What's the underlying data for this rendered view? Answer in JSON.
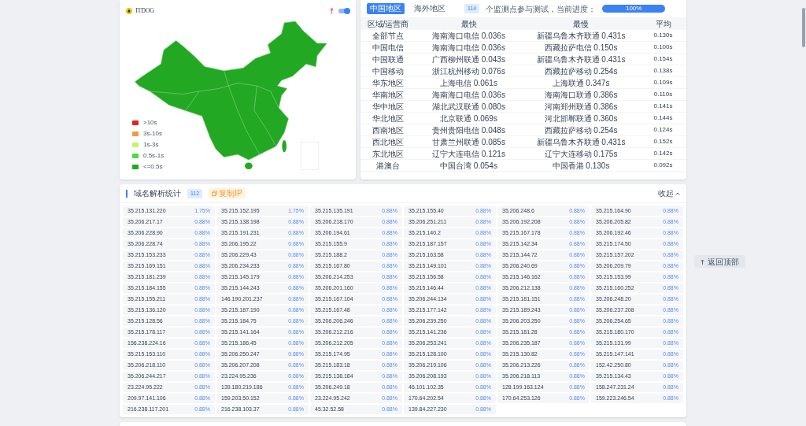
{
  "map_panel": {
    "logo": "ITDOG",
    "toggle": {
      "on": true
    },
    "legend": [
      {
        "label": ">10s",
        "color": "#e52222"
      },
      {
        "label": "3s-10s",
        "color": "#f59a3a"
      },
      {
        "label": "1s-3s",
        "color": "#c3f46a"
      },
      {
        "label": "0.5s-1s",
        "color": "#4bd84b"
      },
      {
        "label": "<=0.5s",
        "color": "#23a823"
      }
    ]
  },
  "region_panel": {
    "tabs": [
      {
        "label": "中国地区",
        "selected": true
      },
      {
        "label": "海外地区",
        "selected": false
      }
    ],
    "node_count": "114",
    "progress_text": "个监测点参与测试，当前进度：",
    "progress": {
      "level": 1,
      "reading": "100%"
    },
    "columns": [
      "区域/运营商",
      "最快",
      "最慢",
      "平均"
    ],
    "rows": [
      {
        "region": "全部节点",
        "fastest": "海南海口电信 0.036s",
        "slowest": "新疆乌鲁木齐联通 0.431s",
        "average": "0.130s"
      },
      {
        "region": "中国电信",
        "fastest": "海南海口电信 0.036s",
        "slowest": "西藏拉萨电信 0.150s",
        "average": "0.100s"
      },
      {
        "region": "中国联通",
        "fastest": "广西柳州联通 0.043s",
        "slowest": "新疆乌鲁木齐联通 0.431s",
        "average": "0.154s"
      },
      {
        "region": "中国移动",
        "fastest": "浙江杭州移动 0.076s",
        "slowest": "西藏拉萨移动 0.254s",
        "average": "0.138s"
      },
      {
        "region": "华东地区",
        "fastest": "上海电信 0.061s",
        "slowest": "上海联通 0.347s",
        "average": "0.109s"
      },
      {
        "region": "华南地区",
        "fastest": "海南海口电信 0.036s",
        "slowest": "海南海口联通 0.386s",
        "average": "0.110s"
      },
      {
        "region": "华中地区",
        "fastest": "湖北武汉联通 0.080s",
        "slowest": "河南郑州联通 0.386s",
        "average": "0.141s"
      },
      {
        "region": "华北地区",
        "fastest": "北京联通 0.069s",
        "slowest": "河北邯郸联通 0.360s",
        "average": "0.144s"
      },
      {
        "region": "西南地区",
        "fastest": "贵州贵阳电信 0.048s",
        "slowest": "西藏拉萨移动 0.254s",
        "average": "0.124s"
      },
      {
        "region": "西北地区",
        "fastest": "甘肃兰州联通 0.085s",
        "slowest": "新疆乌鲁木齐联通 0.431s",
        "average": "0.152s"
      },
      {
        "region": "东北地区",
        "fastest": "辽宁大连电信 0.121s",
        "slowest": "辽宁大连移动 0.175s",
        "average": "0.142s"
      },
      {
        "region": "港澳台",
        "fastest": "中国台湾 0.054s",
        "slowest": "中国香港 0.130s",
        "average": "0.092s"
      }
    ]
  },
  "dns_stats": {
    "title": "域名解析统计",
    "count": "112",
    "copy_button": "复制IP",
    "collapse_button": "收起",
    "items": [
      {
        "ip": "35.215.131.220",
        "share": "1.75%"
      },
      {
        "ip": "35.215.152.195",
        "share": "1.75%"
      },
      {
        "ip": "35.215.135.191",
        "share": "0.88%"
      },
      {
        "ip": "35.215.155.40",
        "share": "0.88%"
      },
      {
        "ip": "35.206.248.6",
        "share": "0.88%"
      },
      {
        "ip": "35.215.164.90",
        "share": "0.88%"
      },
      {
        "ip": "35.206.217.17",
        "share": "0.88%"
      },
      {
        "ip": "35.215.138.198",
        "share": "0.88%"
      },
      {
        "ip": "35.206.218.170",
        "share": "0.88%"
      },
      {
        "ip": "35.206.251.211",
        "share": "0.88%"
      },
      {
        "ip": "35.206.192.208",
        "share": "0.88%"
      },
      {
        "ip": "35.206.205.82",
        "share": "0.88%"
      },
      {
        "ip": "35.206.228.90",
        "share": "0.88%"
      },
      {
        "ip": "35.215.191.231",
        "share": "0.88%"
      },
      {
        "ip": "35.206.194.61",
        "share": "0.88%"
      },
      {
        "ip": "35.215.140.2",
        "share": "0.88%"
      },
      {
        "ip": "35.215.167.178",
        "share": "0.88%"
      },
      {
        "ip": "35.206.192.46",
        "share": "0.88%"
      },
      {
        "ip": "35.206.228.74",
        "share": "0.88%"
      },
      {
        "ip": "35.206.195.22",
        "share": "0.88%"
      },
      {
        "ip": "35.215.155.9",
        "share": "0.88%"
      },
      {
        "ip": "35.215.187.157",
        "share": "0.88%"
      },
      {
        "ip": "35.215.142.34",
        "share": "0.88%"
      },
      {
        "ip": "35.215.174.50",
        "share": "0.88%"
      },
      {
        "ip": "35.215.153.233",
        "share": "0.88%"
      },
      {
        "ip": "35.206.229.43",
        "share": "0.88%"
      },
      {
        "ip": "35.215.188.2",
        "share": "0.88%"
      },
      {
        "ip": "35.215.163.58",
        "share": "0.88%"
      },
      {
        "ip": "35.215.144.72",
        "share": "0.88%"
      },
      {
        "ip": "35.215.157.202",
        "share": "0.88%"
      },
      {
        "ip": "35.215.169.151",
        "share": "0.88%"
      },
      {
        "ip": "35.206.234.233",
        "share": "0.88%"
      },
      {
        "ip": "35.215.167.80",
        "share": "0.88%"
      },
      {
        "ip": "35.215.149.101",
        "share": "0.88%"
      },
      {
        "ip": "35.206.240.69",
        "share": "0.88%"
      },
      {
        "ip": "35.206.209.79",
        "share": "0.88%"
      },
      {
        "ip": "35.215.181.239",
        "share": "0.88%"
      },
      {
        "ip": "35.215.145.179",
        "share": "0.88%"
      },
      {
        "ip": "35.206.214.253",
        "share": "0.88%"
      },
      {
        "ip": "35.215.156.58",
        "share": "0.88%"
      },
      {
        "ip": "35.215.146.162",
        "share": "0.88%"
      },
      {
        "ip": "35.215.153.99",
        "share": "0.88%"
      },
      {
        "ip": "35.215.184.155",
        "share": "0.88%"
      },
      {
        "ip": "35.215.144.243",
        "share": "0.88%"
      },
      {
        "ip": "35.206.201.160",
        "share": "0.88%"
      },
      {
        "ip": "35.215.146.44",
        "share": "0.88%"
      },
      {
        "ip": "35.206.212.138",
        "share": "0.88%"
      },
      {
        "ip": "35.215.160.252",
        "share": "0.88%"
      },
      {
        "ip": "35.215.155.211",
        "share": "0.88%"
      },
      {
        "ip": "146.190.201.237",
        "share": "0.88%"
      },
      {
        "ip": "35.215.167.104",
        "share": "0.88%"
      },
      {
        "ip": "35.206.244.134",
        "share": "0.88%"
      },
      {
        "ip": "35.215.181.151",
        "share": "0.88%"
      },
      {
        "ip": "35.206.248.20",
        "share": "0.88%"
      },
      {
        "ip": "35.215.136.120",
        "share": "0.88%"
      },
      {
        "ip": "35.215.187.190",
        "share": "0.88%"
      },
      {
        "ip": "35.215.167.48",
        "share": "0.88%"
      },
      {
        "ip": "35.215.177.142",
        "share": "0.88%"
      },
      {
        "ip": "35.215.189.243",
        "share": "0.88%"
      },
      {
        "ip": "35.206.237.208",
        "share": "0.88%"
      },
      {
        "ip": "35.215.128.56",
        "share": "0.88%"
      },
      {
        "ip": "35.215.184.75",
        "share": "0.88%"
      },
      {
        "ip": "35.206.206.246",
        "share": "0.88%"
      },
      {
        "ip": "35.206.239.250",
        "share": "0.88%"
      },
      {
        "ip": "35.206.203.250",
        "share": "0.88%"
      },
      {
        "ip": "35.206.254.65",
        "share": "0.88%"
      },
      {
        "ip": "35.215.178.117",
        "share": "0.88%"
      },
      {
        "ip": "35.215.141.164",
        "share": "0.88%"
      },
      {
        "ip": "35.206.212.216",
        "share": "0.88%"
      },
      {
        "ip": "35.215.141.236",
        "share": "0.88%"
      },
      {
        "ip": "35.215.181.28",
        "share": "0.88%"
      },
      {
        "ip": "35.215.180.170",
        "share": "0.88%"
      },
      {
        "ip": "156.238.224.16",
        "share": "0.88%"
      },
      {
        "ip": "35.215.186.45",
        "share": "0.88%"
      },
      {
        "ip": "35.206.212.205",
        "share": "0.88%"
      },
      {
        "ip": "35.206.253.241",
        "share": "0.88%"
      },
      {
        "ip": "35.206.235.187",
        "share": "0.88%"
      },
      {
        "ip": "35.215.131.99",
        "share": "0.88%"
      },
      {
        "ip": "35.215.153.110",
        "share": "0.88%"
      },
      {
        "ip": "35.206.250.247",
        "share": "0.88%"
      },
      {
        "ip": "35.215.174.95",
        "share": "0.88%"
      },
      {
        "ip": "35.215.128.100",
        "share": "0.88%"
      },
      {
        "ip": "35.215.130.82",
        "share": "0.88%"
      },
      {
        "ip": "35.215.147.141",
        "share": "0.88%"
      },
      {
        "ip": "35.206.218.110",
        "share": "0.88%"
      },
      {
        "ip": "35.206.207.208",
        "share": "0.88%"
      },
      {
        "ip": "35.215.183.18",
        "share": "0.88%"
      },
      {
        "ip": "35.206.219.106",
        "share": "0.88%"
      },
      {
        "ip": "35.206.213.226",
        "share": "0.88%"
      },
      {
        "ip": "152.42.250.80",
        "share": "0.88%"
      },
      {
        "ip": "35.206.244.217",
        "share": "0.88%"
      },
      {
        "ip": "23.224.95.236",
        "share": "0.88%"
      },
      {
        "ip": "35.215.138.184",
        "share": "0.88%"
      },
      {
        "ip": "35.206.208.193",
        "share": "0.88%"
      },
      {
        "ip": "35.206.218.113",
        "share": "0.88%"
      },
      {
        "ip": "35.215.134.43",
        "share": "0.88%"
      },
      {
        "ip": "23.224.95.222",
        "share": "0.88%"
      },
      {
        "ip": "139.180.219.186",
        "share": "0.88%"
      },
      {
        "ip": "35.206.249.18",
        "share": "0.88%"
      },
      {
        "ip": "46.101.102.35",
        "share": "0.88%"
      },
      {
        "ip": "128.199.163.124",
        "share": "0.88%"
      },
      {
        "ip": "158.247.231.24",
        "share": "0.88%"
      },
      {
        "ip": "209.97.141.106",
        "share": "0.88%"
      },
      {
        "ip": "159.203.50.152",
        "share": "0.88%"
      },
      {
        "ip": "23.224.95.242",
        "share": "0.88%"
      },
      {
        "ip": "170.64.202.54",
        "share": "0.88%"
      },
      {
        "ip": "170.64.253.126",
        "share": "0.88%"
      },
      {
        "ip": "159.223.246.54",
        "share": "0.88%"
      },
      {
        "ip": "216.238.117.201",
        "share": "0.88%"
      },
      {
        "ip": "216.238.103.37",
        "share": "0.88%"
      },
      {
        "ip": "45.32.52.58",
        "share": "0.88%"
      },
      {
        "ip": "139.84.227.230",
        "share": "0.88%"
      }
    ]
  },
  "back_to_top": "返回顶部"
}
